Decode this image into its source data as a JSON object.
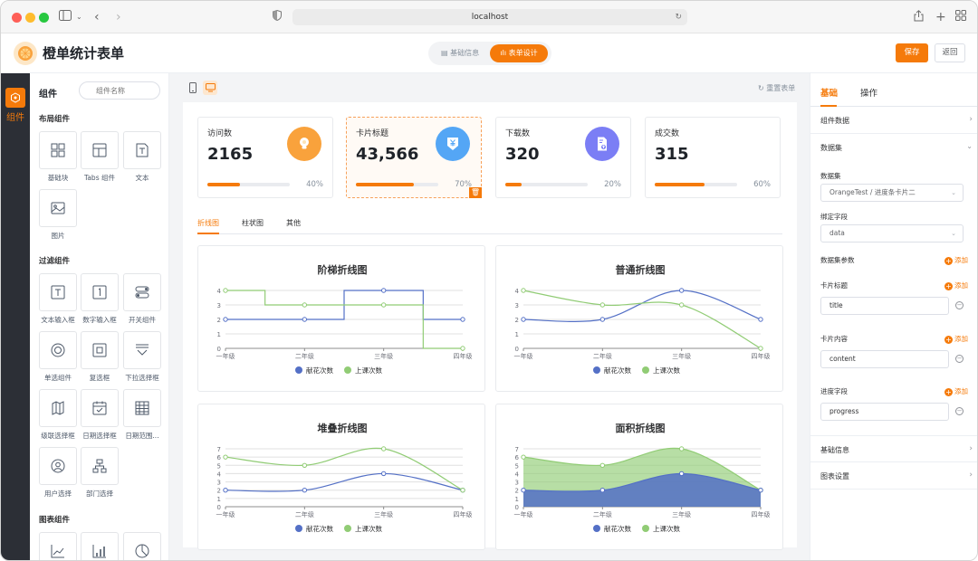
{
  "browser": {
    "url": "localhost"
  },
  "app": {
    "title": "橙单统计表单",
    "save": "保存",
    "back": "返回"
  },
  "mode_tabs": [
    "基础信息",
    "表单设计"
  ],
  "rail": {
    "label": "组件"
  },
  "panel": {
    "title": "组件",
    "search_placeholder": "组件名称",
    "groups": [
      {
        "title": "布局组件",
        "items": [
          "基础块",
          "Tabs 组件",
          "文本",
          "图片"
        ]
      },
      {
        "title": "过滤组件",
        "items": [
          "文本输入框",
          "数字输入框",
          "开关组件",
          "单选组件",
          "复选框",
          "下拉选择框",
          "级联选择框",
          "日期选择框",
          "日期范围...",
          "用户选择",
          "部门选择"
        ]
      },
      {
        "title": "图表组件",
        "items": [
          "",
          "",
          ""
        ]
      }
    ]
  },
  "canvas": {
    "reset": "重置表单"
  },
  "cards": [
    {
      "title": "访问数",
      "value": "2165",
      "percent_label": "40%",
      "progress": 0.4,
      "icon": "lightbulb-icon",
      "color": "#f9a23c"
    },
    {
      "title": "卡片标题",
      "value": "43,566",
      "percent_label": "70%",
      "progress": 0.7,
      "icon": "yen-download-icon",
      "color": "#54a6f5"
    },
    {
      "title": "下载数",
      "value": "320",
      "percent_label": "20%",
      "progress": 0.2,
      "icon": "file-upload-icon",
      "color": "#7b7ef5"
    },
    {
      "title": "成交数",
      "value": "315",
      "percent_label": "60%",
      "progress": 0.6,
      "icon": "",
      "color": ""
    }
  ],
  "chart_tabs": [
    "折线图",
    "柱状图",
    "其他"
  ],
  "chart_data": [
    {
      "type": "line",
      "style": "step",
      "title": "阶梯折线图",
      "categories": [
        "一年级",
        "二年级",
        "三年级",
        "四年级"
      ],
      "ylim": [
        0,
        4
      ],
      "yticks": [
        0,
        1,
        2,
        3,
        4
      ],
      "series": [
        {
          "name": "献花次数",
          "values": [
            2,
            2,
            4,
            2
          ],
          "color": "#5470c6"
        },
        {
          "name": "上课次数",
          "values": [
            4,
            3,
            3,
            0
          ],
          "color": "#91cc75"
        }
      ],
      "legend": "bottom"
    },
    {
      "type": "line",
      "style": "smooth",
      "title": "普通折线图",
      "categories": [
        "一年级",
        "二年级",
        "三年级",
        "四年级"
      ],
      "ylim": [
        0,
        4
      ],
      "yticks": [
        0,
        1,
        2,
        3,
        4
      ],
      "series": [
        {
          "name": "献花次数",
          "values": [
            2,
            2,
            4,
            2
          ],
          "color": "#5470c6"
        },
        {
          "name": "上课次数",
          "values": [
            4,
            3,
            3,
            0
          ],
          "color": "#91cc75"
        }
      ],
      "legend": "bottom"
    },
    {
      "type": "line",
      "style": "smooth",
      "title": "堆叠折线图",
      "categories": [
        "一年级",
        "二年级",
        "三年级",
        "四年级"
      ],
      "ylim": [
        0,
        7
      ],
      "yticks": [
        0,
        1,
        2,
        3,
        4,
        5,
        6,
        7
      ],
      "series": [
        {
          "name": "献花次数",
          "values": [
            2,
            2,
            4,
            2
          ],
          "color": "#5470c6"
        },
        {
          "name": "上课次数",
          "values": [
            6,
            5,
            7,
            2
          ],
          "color": "#91cc75"
        }
      ],
      "legend": "bottom"
    },
    {
      "type": "area",
      "style": "smooth",
      "title": "面积折线图",
      "categories": [
        "一年级",
        "二年级",
        "三年级",
        "四年级"
      ],
      "ylim": [
        0,
        7
      ],
      "yticks": [
        0,
        1,
        2,
        3,
        4,
        5,
        6,
        7
      ],
      "series": [
        {
          "name": "献花次数",
          "values": [
            2,
            2,
            4,
            2
          ],
          "color": "#5470c6"
        },
        {
          "name": "上课次数",
          "values": [
            6,
            5,
            7,
            2
          ],
          "color": "#91cc75"
        }
      ],
      "legend": "bottom"
    }
  ],
  "right": {
    "tabs": [
      "基础",
      "操作"
    ],
    "comp_data": "组件数据",
    "dataset_section": "数据集",
    "dataset_label": "数据集",
    "dataset_value": "OrangeTest / 进度条卡片二",
    "bind_label": "绑定字段",
    "bind_value": "data",
    "params_label": "数据集参数",
    "add": "添加",
    "fields": [
      {
        "label": "卡片标题",
        "value": "title"
      },
      {
        "label": "卡片内容",
        "value": "content"
      },
      {
        "label": "进度字段",
        "value": "progress"
      }
    ],
    "basic_info": "基础信息",
    "chart_settings": "图表设置"
  }
}
